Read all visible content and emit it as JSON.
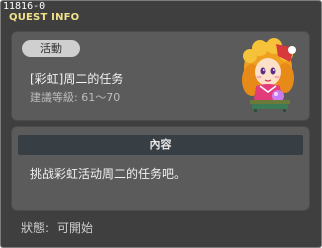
{
  "window": {
    "quest_id": "11816-0",
    "title": "QUEST INFO"
  },
  "quest": {
    "category": "活動",
    "name": "[彩虹]周二的任务",
    "level_req": "建議等級: 61～70",
    "npc_icon": "npc-portrait-icon"
  },
  "content_section": {
    "header": "內容",
    "description": "挑战彩虹活动周二的任务吧。"
  },
  "status": {
    "label": "狀態:",
    "value": "可開始"
  },
  "colors": {
    "background": "#3f3f3f",
    "panel": "#5b5b5b",
    "header_bar": "#373f45",
    "title_text": "#f2e18a",
    "badge": "#cfcfcf"
  }
}
